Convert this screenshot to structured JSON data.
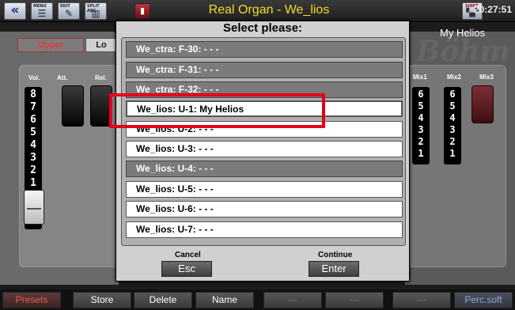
{
  "topbar": {
    "back_icon": "double-chevron-left",
    "btn_menu_label": "MENU",
    "btn_edit_label": "EDIT",
    "btn_split_label": "SPLIT ABC",
    "title": "Real Organ - We_lios",
    "shift_label": "SHIFT",
    "clock": "20:27:51"
  },
  "left_panel": {
    "tab_upper": "Upper",
    "tab_lower": "Lo",
    "col_vol": "Vol.",
    "col_att": "Att.",
    "col_rel": "Rel.",
    "volume_scale": [
      "8",
      "7",
      "6",
      "5",
      "4",
      "3",
      "2",
      "1"
    ]
  },
  "right_panel": {
    "title": "My Helios",
    "watermark": "Böhm",
    "col_mix1": "Mix1",
    "col_mix2": "Mix2",
    "col_mix3": "Mix3",
    "mix1_scale": [
      "6",
      "5",
      "4",
      "3",
      "2",
      "1"
    ],
    "mix2_scale": [
      "6",
      "5",
      "4",
      "3",
      "2",
      "1"
    ]
  },
  "dialog": {
    "title": "Select please:",
    "items": [
      {
        "label": "We_ctra: F-30: - - -",
        "state": "sel"
      },
      {
        "label": "We_ctra: F-31: - - -",
        "state": "sel"
      },
      {
        "label": "We_ctra: F-32: - - -",
        "state": "sel"
      },
      {
        "label": "We_lios: U-1: My Helios",
        "state": "hl"
      },
      {
        "label": "We_lios: U-2: - - -",
        "state": "unsel"
      },
      {
        "label": "We_lios: U-3: - - -",
        "state": "unsel"
      },
      {
        "label": "We_lios: U-4: - - -",
        "state": "sel"
      },
      {
        "label": "We_lios: U-5: - - -",
        "state": "unsel"
      },
      {
        "label": "We_lios: U-6: - - -",
        "state": "unsel"
      },
      {
        "label": "We_lios: U-7: - - -",
        "state": "unsel"
      }
    ],
    "cancel_label": "Cancel",
    "cancel_key": "Esc",
    "continue_label": "Continue",
    "continue_key": "Enter"
  },
  "bottombar": {
    "buttons": [
      "Presets",
      "Store",
      "Delete",
      "Name",
      "---",
      "---",
      "---",
      "Perc.soft"
    ]
  },
  "colors": {
    "title_yellow": "#f2dc28",
    "highlight_red": "#e4001b",
    "active_red": "#e85a5a"
  }
}
